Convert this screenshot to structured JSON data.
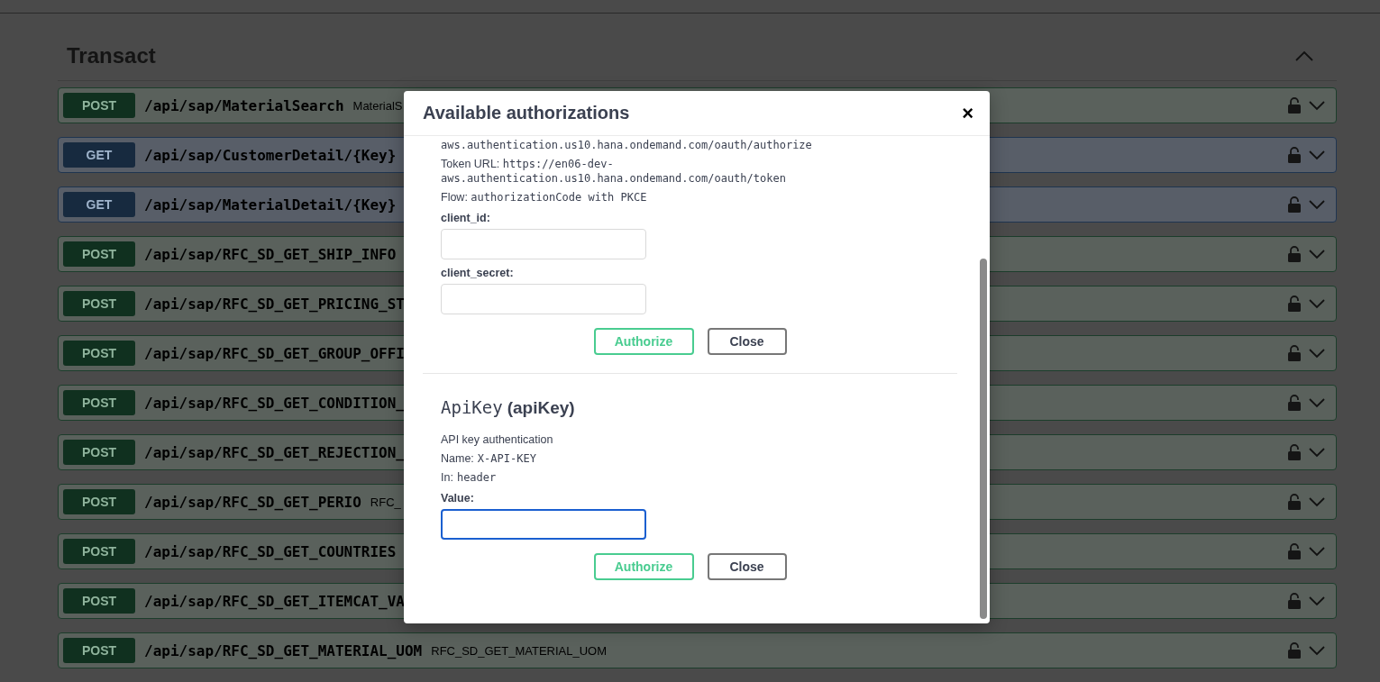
{
  "section": {
    "title": "Transact",
    "expanded": true
  },
  "operations": [
    {
      "method": "POST",
      "path": "/api/sap/MaterialSearch",
      "summary": "MaterialS"
    },
    {
      "method": "GET",
      "path": "/api/sap/CustomerDetail/{Key}"
    },
    {
      "method": "GET",
      "path": "/api/sap/MaterialDetail/{Key}"
    },
    {
      "method": "POST",
      "path": "/api/sap/RFC_SD_GET_SHIP_INFO"
    },
    {
      "method": "POST",
      "path": "/api/sap/RFC_SD_GET_PRICING_ST"
    },
    {
      "method": "POST",
      "path": "/api/sap/RFC_SD_GET_GROUP_OFFI"
    },
    {
      "method": "POST",
      "path": "/api/sap/RFC_SD_GET_CONDITION_"
    },
    {
      "method": "POST",
      "path": "/api/sap/RFC_SD_GET_REJECTION_"
    },
    {
      "method": "POST",
      "path": "/api/sap/RFC_SD_GET_PERIO",
      "summary": "RFC_"
    },
    {
      "method": "POST",
      "path": "/api/sap/RFC_SD_GET_COUNTRIES"
    },
    {
      "method": "POST",
      "path": "/api/sap/RFC_SD_GET_ITEMCAT_VA"
    },
    {
      "method": "POST",
      "path": "/api/sap/RFC_SD_GET_MATERIAL_UOM",
      "summary": "RFC_SD_GET_MATERIAL_UOM"
    }
  ],
  "modal": {
    "title": "Available authorizations",
    "close": "×",
    "oauth": {
      "authorization_url_tail": "aws.authentication.us10.hana.ondemand.com/oauth/authorize",
      "token_url_label": "Token URL:",
      "token_url": "https://en06-dev-aws.authentication.us10.hana.ondemand.com/oauth/token",
      "flow_label": "Flow:",
      "flow": "authorizationCode with PKCE",
      "fields": [
        {
          "label": "client_id:",
          "focused": false
        },
        {
          "label": "client_secret:",
          "focused": false
        }
      ],
      "buttons": [
        "Authorize",
        "Close"
      ]
    },
    "api_key": {
      "name": "ApiKey",
      "type": "(apiKey)",
      "description": "API key authentication",
      "name_label": "Name:",
      "key_name": "X-API-KEY",
      "in_label": "In:",
      "in": "header",
      "fields": [
        {
          "label": "Value:",
          "focused": true
        }
      ],
      "buttons": [
        "Authorize",
        "Close"
      ]
    }
  }
}
